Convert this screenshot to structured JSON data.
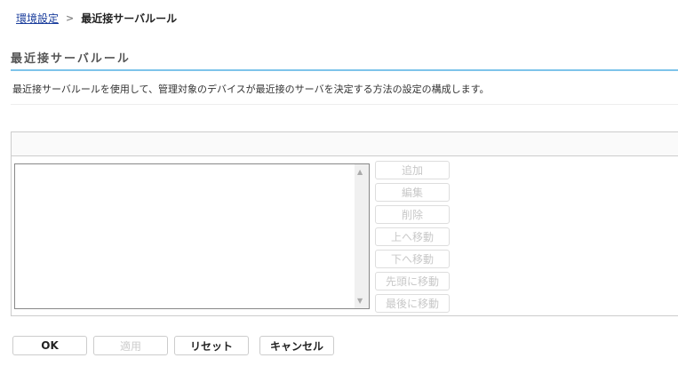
{
  "breadcrumb": {
    "parent": "環境設定",
    "separator": ">",
    "current": "最近接サーバルール"
  },
  "page": {
    "title": "最近接サーバルール",
    "description": "最近接サーバルールを使用して、管理対象のデバイスが最近接のサーバを決定する方法の設定の構成します。"
  },
  "side_buttons": [
    "追加",
    "編集",
    "削除",
    "上へ移動",
    "下へ移動",
    "先頭に移動",
    "最後に移動"
  ],
  "footer": {
    "ok": "OK",
    "apply": "適用",
    "reset": "リセット",
    "cancel": "キャンセル"
  },
  "colors": {
    "accent_line": "#7ec4ea",
    "link": "#1a3d9c"
  }
}
